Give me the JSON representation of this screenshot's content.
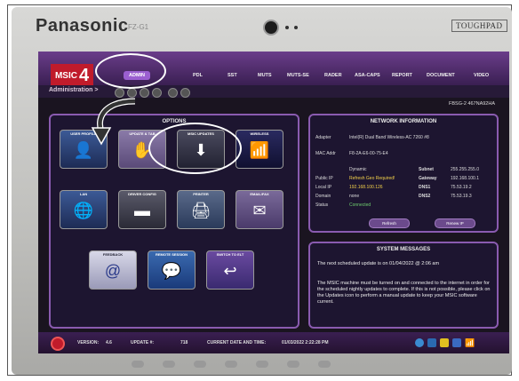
{
  "device": {
    "brand": "Panasonic",
    "model": "FZ-G1",
    "badge": "TOUGHPAD"
  },
  "app": {
    "logo_text": "MSIC",
    "logo_num": "4",
    "tabs": [
      "ADMIN",
      "PDL",
      "SST",
      "MUTS",
      "MUTS-SE",
      "RADER",
      "ASA-CAPS",
      "REPORT",
      "DOCUMENT",
      "VIDEO"
    ],
    "active_tab": "ADMIN",
    "breadcrumb": "Administration >",
    "serial": "FBSG-2  467NA92HA"
  },
  "options": {
    "title": "OPTIONS",
    "tiles": [
      {
        "label": "USER PROFILE",
        "icon": "user-icon",
        "glyph": "👤"
      },
      {
        "label": "UPDATE & TAB",
        "icon": "update-tab-icon",
        "glyph": "✋"
      },
      {
        "label": "MSIC UPDATES",
        "icon": "download-icon",
        "glyph": "⬇"
      },
      {
        "label": "WIRELESS",
        "icon": "wifi-icon",
        "glyph": "📶"
      },
      {
        "label": "LAN",
        "icon": "globe-icon",
        "glyph": "🌐"
      },
      {
        "label": "DRIVER CONFIG",
        "icon": "scanner-icon",
        "glyph": "▬"
      },
      {
        "label": "PRINTER",
        "icon": "printer-icon",
        "glyph": "🖨"
      },
      {
        "label": "EMAIL/FAX",
        "icon": "envelope-icon",
        "glyph": "✉"
      },
      {
        "label": "FEEDBACK",
        "icon": "email-at-icon",
        "glyph": "@"
      },
      {
        "label": "REMOTE SESSION",
        "icon": "chat-icon",
        "glyph": "💬"
      },
      {
        "label": "SWITCH TO ELT",
        "icon": "return-arrow-icon",
        "glyph": "↩"
      }
    ]
  },
  "network": {
    "title": "NETWORK INFORMATION",
    "adapter_label": "Adapter",
    "adapter": "Intel(R) Dual Band Wireless-AC 7260 #8",
    "mac_label": "MAC Addr",
    "mac": "F8-2A-E6-00-75-E4",
    "mode": "Dynamic",
    "public_label": "Public IP",
    "public_ip": "Refresh Geo Required!",
    "local_label": "Local IP",
    "local_ip": "192.168.100.126",
    "domain_label": "Domain",
    "domain": "none",
    "status_label": "Status",
    "status": "Connected",
    "subnet_label": "Subnet",
    "subnet": "255.255.255.0",
    "gateway_label": "Gateway",
    "gateway": "192.168.100.1",
    "dns1_label": "DNS1",
    "dns1": "75.53.19.2",
    "dns2_label": "DNS2",
    "dns2": "75.53.19.3",
    "refresh_button": "Refresh",
    "renew_button": "Renew IP"
  },
  "messages": {
    "title": "SYSTEM MESSAGES",
    "line1": "The next scheduled update is on 01/04/2022 @ 2:06 am",
    "line2": "The MSIC machine must be turned on and connected to the internet in order for the scheduled nightly updates to complete. If this is not possible, please click on the Updates icon to perform a manual update to keep your MSIC software current."
  },
  "statusbar": {
    "version_label": "VERSION:",
    "version": "4.6",
    "update_label": "UPDATE #:",
    "update": "718",
    "datetime_label": "CURRENT DATE AND TIME:",
    "datetime": "01/03/2022 2:22:28 PM"
  },
  "colors": {
    "accent": "#8a5bb0",
    "logo": "#c01b2b",
    "highlight": "#f2d04a",
    "connected": "#6fcf6f"
  }
}
